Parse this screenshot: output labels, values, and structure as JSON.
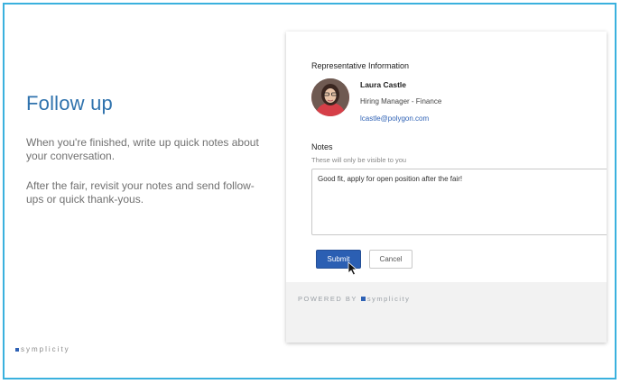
{
  "slide": {
    "title": "Follow up",
    "paragraph1": "When you're finished, write up quick notes about your conversation.",
    "paragraph2": "After the fair, revisit your notes and send follow-ups or quick thank-yous.",
    "brand": "symplicity",
    "border_color": "#3ab1de",
    "title_color": "#2f72ad"
  },
  "screen": {
    "section_header": "Representative Information",
    "representative": {
      "name": "Laura Castle",
      "role": "Hiring Manager - Finance",
      "email": "lcastle@polygon.com",
      "avatar_icon": "person-avatar"
    },
    "notes": {
      "label": "Notes",
      "hint": "These will only be visible to you",
      "value": "Good fit, apply for open position after the fair!"
    },
    "buttons": {
      "submit": "Submit",
      "cancel": "Cancel"
    },
    "footer": {
      "powered_by": "POWERED BY",
      "brand": "symplicity"
    },
    "accent_color": "#2b5fb3"
  }
}
